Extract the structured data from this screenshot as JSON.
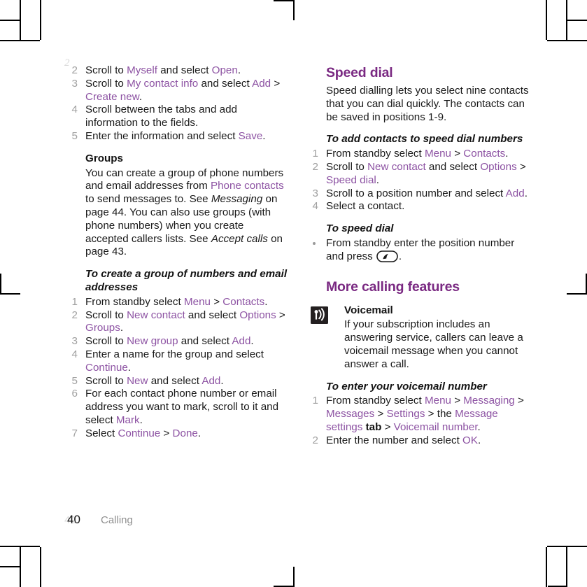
{
  "document": {
    "footer": {
      "page_number": "40",
      "chapter": "Calling"
    },
    "ghost_marks": {
      "top_left": "2",
      "bottom_left": "40"
    }
  },
  "colors": {
    "heading_purple": "#7a2982",
    "link_purple": "#8d53a3",
    "body_black": "#1a1a1a",
    "step_number_gray": "#a0a0a0",
    "footer_gray": "#8f8f8f"
  },
  "left_column": {
    "continued_steps": [
      {
        "num": "2",
        "parts": [
          {
            "t": "Scroll to ",
            "s": "plain"
          },
          {
            "t": "Myself",
            "s": "link"
          },
          {
            "t": " and select ",
            "s": "plain"
          },
          {
            "t": "Open",
            "s": "link"
          },
          {
            "t": ".",
            "s": "plain"
          }
        ]
      },
      {
        "num": "3",
        "parts": [
          {
            "t": "Scroll to ",
            "s": "plain"
          },
          {
            "t": "My contact info",
            "s": "link"
          },
          {
            "t": " and select ",
            "s": "plain"
          },
          {
            "t": "Add",
            "s": "link"
          },
          {
            "t": " > ",
            "s": "plain"
          },
          {
            "t": "Create new",
            "s": "link"
          },
          {
            "t": ".",
            "s": "plain"
          }
        ]
      },
      {
        "num": "4",
        "parts": [
          {
            "t": "Scroll between the tabs and add information to the fields.",
            "s": "plain"
          }
        ]
      },
      {
        "num": "5",
        "parts": [
          {
            "t": "Enter the information and select ",
            "s": "plain"
          },
          {
            "t": "Save",
            "s": "link"
          },
          {
            "t": ".",
            "s": "plain"
          }
        ]
      }
    ],
    "groups": {
      "title": "Groups",
      "paragraph_parts": [
        {
          "t": "You can create a group of phone numbers and email addresses from ",
          "s": "plain"
        },
        {
          "t": "Phone contacts",
          "s": "link"
        },
        {
          "t": " to send messages to. See ",
          "s": "plain"
        },
        {
          "t": "Messaging",
          "s": "italic"
        },
        {
          "t": " on page 44. You can also use groups (with phone numbers) when you create accepted callers lists. See ",
          "s": "plain"
        },
        {
          "t": "Accept calls",
          "s": "italic"
        },
        {
          "t": " on page 43.",
          "s": "plain"
        }
      ],
      "procedure_title": "To create a group of numbers and email addresses",
      "steps": [
        {
          "num": "1",
          "parts": [
            {
              "t": "From standby select ",
              "s": "plain"
            },
            {
              "t": "Menu",
              "s": "link"
            },
            {
              "t": " > ",
              "s": "plain"
            },
            {
              "t": "Contacts",
              "s": "link"
            },
            {
              "t": ".",
              "s": "plain"
            }
          ]
        },
        {
          "num": "2",
          "parts": [
            {
              "t": "Scroll to ",
              "s": "plain"
            },
            {
              "t": "New contact",
              "s": "link"
            },
            {
              "t": " and select ",
              "s": "plain"
            },
            {
              "t": "Options",
              "s": "link"
            },
            {
              "t": " > ",
              "s": "plain"
            },
            {
              "t": "Groups",
              "s": "link"
            },
            {
              "t": ".",
              "s": "plain"
            }
          ]
        },
        {
          "num": "3",
          "parts": [
            {
              "t": "Scroll to ",
              "s": "plain"
            },
            {
              "t": "New group",
              "s": "link"
            },
            {
              "t": " and select ",
              "s": "plain"
            },
            {
              "t": "Add",
              "s": "link"
            },
            {
              "t": ".",
              "s": "plain"
            }
          ]
        },
        {
          "num": "4",
          "parts": [
            {
              "t": "Enter a name for the group and select ",
              "s": "plain"
            },
            {
              "t": "Continue",
              "s": "link"
            },
            {
              "t": ".",
              "s": "plain"
            }
          ]
        },
        {
          "num": "5",
          "parts": [
            {
              "t": "Scroll to ",
              "s": "plain"
            },
            {
              "t": "New",
              "s": "link"
            },
            {
              "t": " and select ",
              "s": "plain"
            },
            {
              "t": "Add",
              "s": "link"
            },
            {
              "t": ".",
              "s": "plain"
            }
          ]
        },
        {
          "num": "6",
          "parts": [
            {
              "t": "For each contact phone number or email address you want to mark, scroll to it and select ",
              "s": "plain"
            },
            {
              "t": "Mark",
              "s": "link"
            },
            {
              "t": ".",
              "s": "plain"
            }
          ]
        },
        {
          "num": "7",
          "parts": [
            {
              "t": "Select ",
              "s": "plain"
            },
            {
              "t": "Continue",
              "s": "link"
            },
            {
              "t": " > ",
              "s": "plain"
            },
            {
              "t": "Done",
              "s": "link"
            },
            {
              "t": ".",
              "s": "plain"
            }
          ]
        }
      ]
    }
  },
  "right_column": {
    "speed_dial": {
      "title": "Speed dial",
      "paragraph_parts": [
        {
          "t": "Speed dialling lets you select nine contacts that you can dial quickly. The contacts can be saved in positions 1-9.",
          "s": "plain"
        }
      ],
      "procedure_title": "To add contacts to speed dial numbers",
      "steps": [
        {
          "num": "1",
          "parts": [
            {
              "t": "From standby select ",
              "s": "plain"
            },
            {
              "t": "Menu",
              "s": "link"
            },
            {
              "t": " > ",
              "s": "plain"
            },
            {
              "t": "Contacts",
              "s": "link"
            },
            {
              "t": ".",
              "s": "plain"
            }
          ]
        },
        {
          "num": "2",
          "parts": [
            {
              "t": "Scroll to ",
              "s": "plain"
            },
            {
              "t": "New contact",
              "s": "link"
            },
            {
              "t": " and select ",
              "s": "plain"
            },
            {
              "t": "Options",
              "s": "link"
            },
            {
              "t": " > ",
              "s": "plain"
            },
            {
              "t": "Speed dial",
              "s": "link"
            },
            {
              "t": ".",
              "s": "plain"
            }
          ]
        },
        {
          "num": "3",
          "parts": [
            {
              "t": "Scroll to a position number and select ",
              "s": "plain"
            },
            {
              "t": "Add",
              "s": "link"
            },
            {
              "t": ".",
              "s": "plain"
            }
          ]
        },
        {
          "num": "4",
          "parts": [
            {
              "t": "Select a contact.",
              "s": "plain"
            }
          ]
        }
      ],
      "speed_dial_procedure_title": "To speed dial",
      "speed_dial_bullet": [
        {
          "t": "From standby enter the position number and press ",
          "s": "plain"
        },
        {
          "t": "call-key-icon",
          "s": "icon"
        },
        {
          "t": ".",
          "s": "plain"
        }
      ]
    },
    "more_calling_features": {
      "title": "More calling features",
      "voicemail": {
        "icon": "voicemail-icon",
        "heading": "Voicemail",
        "paragraph_parts": [
          {
            "t": "If your subscription includes an answering service, callers can leave a voicemail message when you cannot answer a call.",
            "s": "plain"
          }
        ],
        "procedure_title": "To enter your voicemail number",
        "steps": [
          {
            "num": "1",
            "parts": [
              {
                "t": "From standby select ",
                "s": "plain"
              },
              {
                "t": "Menu",
                "s": "link"
              },
              {
                "t": " > ",
                "s": "plain"
              },
              {
                "t": "Messaging",
                "s": "link"
              },
              {
                "t": " > ",
                "s": "plain"
              },
              {
                "t": "Messages",
                "s": "link"
              },
              {
                "t": " > ",
                "s": "plain"
              },
              {
                "t": "Settings",
                "s": "link"
              },
              {
                "t": " > the ",
                "s": "plain"
              },
              {
                "t": "Message settings",
                "s": "link"
              },
              {
                "t": " tab",
                "s": "bold"
              },
              {
                "t": " > ",
                "s": "plain"
              },
              {
                "t": "Voicemail number",
                "s": "link"
              },
              {
                "t": ".",
                "s": "plain"
              }
            ]
          },
          {
            "num": "2",
            "parts": [
              {
                "t": "Enter the number and select ",
                "s": "plain"
              },
              {
                "t": "OK",
                "s": "link"
              },
              {
                "t": ".",
                "s": "plain"
              }
            ]
          }
        ]
      }
    }
  }
}
